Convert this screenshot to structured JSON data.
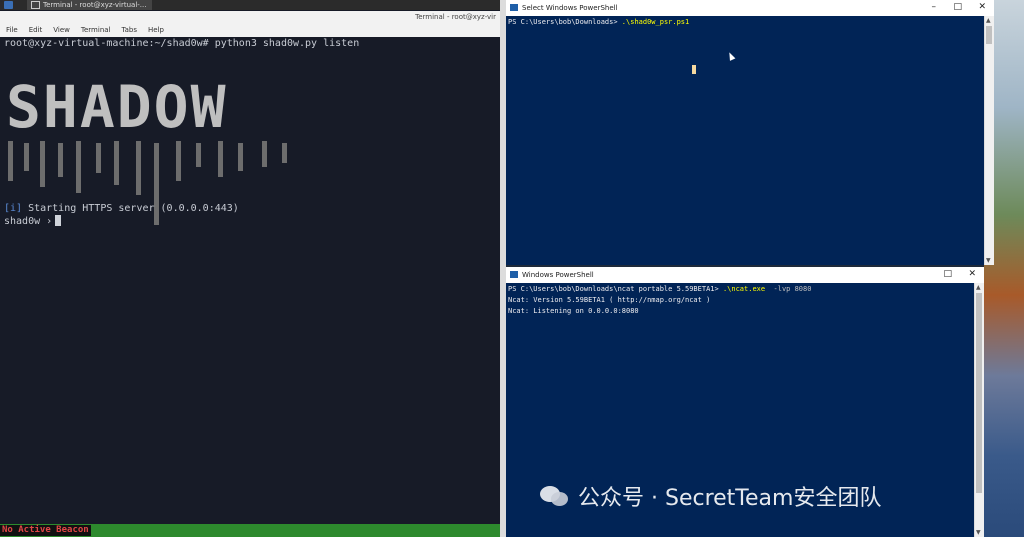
{
  "taskbar": {
    "task_label": "Terminal - root@xyz-virtual-..."
  },
  "terminal": {
    "window_title": "Terminal - root@xyz-vir",
    "menu": [
      "File",
      "Edit",
      "View",
      "Terminal",
      "Tabs",
      "Help"
    ],
    "prompt_line": "root@xyz-virtual-machine:~/shad0w# python3 shad0w.py listen",
    "banner": "SHADOW",
    "info_tag": "[i]",
    "info_text": " Starting HTTPS server (0.0.0.0:443)",
    "shell_prompt": "shad0w ›",
    "status": "No Active Beacon",
    "colors": {
      "status_bar": "#2d8a2d",
      "status_text": "#e04646",
      "info": "#5b8bd6"
    }
  },
  "ps_top": {
    "title": "Select Windows PowerShell",
    "prompt": "PS C:\\Users\\bob\\Downloads> ",
    "command": ".\\shad0w_psr.ps1",
    "controls": {
      "min": "–",
      "max": "□",
      "close": "✕"
    },
    "background": "#012456"
  },
  "ps_bottom": {
    "title": "Windows PowerShell",
    "prompt": "PS C:\\Users\\bob\\Downloads\\ncat portable 5.59BETA1> ",
    "command": ".\\ncat.exe",
    "args": "  -lvp 8080",
    "output": [
      "Ncat: Version 5.59BETA1 ( http://nmap.org/ncat )",
      "Ncat: Listening on 0.0.0.0:8080"
    ],
    "controls": {
      "max": "□",
      "close": "✕"
    }
  },
  "watermark": {
    "text": "公众号 · SecretTeam安全团队"
  }
}
